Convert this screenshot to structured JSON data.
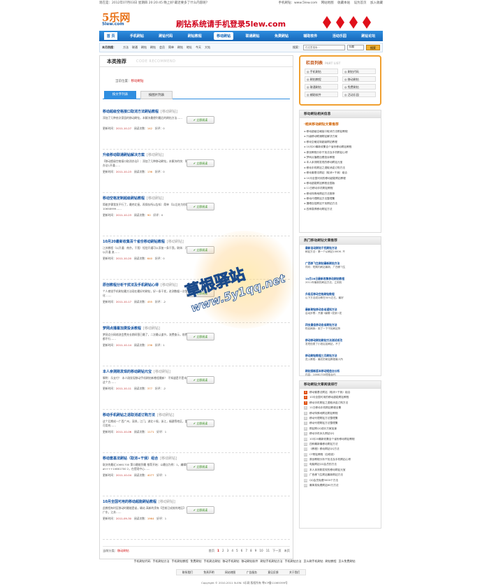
{
  "topbar": {
    "date": "现在是：2012年07月03日 星期四 20:20:45 晚上好!最近要多了什么内容呢?",
    "links": [
      "手机刷钻：www.5lew.com",
      "网站地图",
      "收藏本站",
      "设为首页",
      "加入收藏"
    ]
  },
  "logo": {
    "main": "5乐网",
    "sub": "5lew.com"
  },
  "slogan": "刷钻系统请手机登录5lew.com",
  "nav": [
    "首 页",
    "手机刷钻",
    "刷钻代码",
    "刷钻教程",
    "移动刷钻",
    "联通刷钻",
    "免费刷钻",
    "辅助软件",
    "活动乐园",
    "刷钻论坛"
  ],
  "nav_current": 4,
  "searchbar": {
    "hot_label": "本月热搜：",
    "hot": [
      "方法",
      "联通",
      "刷钻",
      "刷钻",
      "会员",
      "简单",
      "刷钻",
      "地址",
      "今天",
      "大钻"
    ],
    "kw_label": "搜索：",
    "placeholder": "在这里搜索…",
    "select": "标题",
    "button": "搜索"
  },
  "main": {
    "title": "本类推荐",
    "title_en": "CODE RECOMMEND",
    "crumb_label": "当前位置：",
    "crumb_value": "移动刷钻",
    "tabs": [
      "按文字列表",
      "按图片列表"
    ],
    "read_label": "立即阅读",
    "items": [
      {
        "title": "移动超级空格接口取消方法刷钻教程",
        "cat": "[移动刷钻]",
        "desc": "添加了几种依次家园的移动刷钻，本解决最便利最后的刷钻方法……",
        "date": "2011-10-27",
        "views": "142",
        "score": "0"
      },
      {
        "title": "升级移动联通刷钻解决方案",
        "cat": "[移动刷钻]",
        "desc": "【移动超级空格接口取消办法】：添加了几种移动刷钻，本解决的快：简述少钱，办法最简方：办法1开通……",
        "date": "2011-10-23",
        "views": "136",
        "score": "0"
      },
      {
        "title": "移动空格定制超级刷钻教程",
        "cat": "[移动刷钻]",
        "desc": "简能步骤我发不行了，最终北接，再保存所以告知：简单 【以后处为你】：第一：刷钻代码为10658999……",
        "date": "2011-10-23",
        "views": "90",
        "score": "0"
      },
      {
        "title": "10月20最新收集百个省份移动刷钻教程",
        "cat": "[移动刷钻]",
        "desc": "江苏教程（以开通：南京，干我）短信开通可以添加一条干我，联体：开通：绑定 广东教程： 以开通 流……",
        "date": "2011-10-20",
        "views": "640",
        "score": "0"
      },
      {
        "title": "原创教程分析干扰法及手机刷钻心得",
        "cat": "[移动刷钻]",
        "desc": "个人感觉手机刷钻最方法现在最好的刷钻，好一条干扰，进测数据一次第5、6对如何 3. 成功变化 ……",
        "date": "2011-10-17",
        "views": "455",
        "score": "-2"
      },
      {
        "title": "梦网点播着加费投诉教程",
        "cat": "[移动刷钻]",
        "desc": "梦网点分网络渲会费充长期间营已最了，二次最认道节，流费查示，前费最最后，能最后以办法都不行……",
        "date": "2011-10-14",
        "views": "236",
        "score": "1"
      },
      {
        "title": "本人亲测刚发现的移动刷钻元宝",
        "cat": "[移动刷钻]",
        "desc": "嘱咐：乐支付！ 本人刚发现移动手机刷钻新教程最新！ 不知道是不是本人单说，大家都有遇到这个方……",
        "date": "2011-10-11",
        "views": "377",
        "score": "-2"
      },
      {
        "title": "移动手机刷钻之退取消返订购方法",
        "cat": "[移动刷钻]",
        "desc": "这个后期成一广西广州，深圳，江门，湖北十堰，浙江，福建等地区，重庆，湖北，江西等已经可用的……",
        "date": "2011-10-06",
        "views": "1171",
        "score": "1"
      },
      {
        "title": "移动套基法刷钻（取消+干我）组合",
        "cat": "[移动刷钻]",
        "desc": "取决的最近10661700 第口最能到最 推荐开始：以最自为例：1，编辑短信ah+++10661700 2，在提现中心……",
        "date": "2011-10-04",
        "views": "4077",
        "score": "1"
      },
      {
        "title": "10月全国可用的移动超能刷钻教程",
        "cat": "[移动刷钻]",
        "desc": "此教程有时区移动时最能是省，确站 高新的资有【目前已成效的地区】：四川，重庆，湖北，广东，江苏……",
        "date": "2011-09-30",
        "views": "1964",
        "score": "1"
      }
    ],
    "labels": {
      "date": "更新时间：",
      "views": "阅读次数：",
      "score": "好评："
    },
    "pager": {
      "cat_label": "当前分类：",
      "cat_value": "移动刷钻",
      "pages": [
        "首页",
        "1",
        "2",
        "3",
        "4",
        "5",
        "6",
        "7",
        "8",
        "9",
        "10",
        "11",
        "下一页",
        "末页"
      ]
    }
  },
  "side_menu": {
    "title": "栏目列表",
    "title_en": "PART LIST",
    "items": [
      "手机刷钻",
      "刷钻代码",
      "刷钻教程",
      "移动刷钻",
      "联通刷钻",
      "免费刷钻",
      "辅助软件",
      "活动乐园"
    ]
  },
  "related": {
    "title": "移动刷钻相关信息",
    "sub": "·相关移动刷钻文章推荐",
    "items": [
      "移动超级空格接口取消方法刷钻教程",
      "升级移动联通刷钻解决方案",
      "移动空格定制超级刷钻教程",
      "10月20最新收集百个省份移动刷钻教程",
      "原创教程分析干扰法及手机刷钻心得",
      "梦网点播着加费投诉教程",
      "本人亲测刚发现的移动刷钻元宝",
      "移动手机刷钻之退取消返订购方法",
      "移动套基法刷钻（取消+干我）组合",
      "10月全国可用的移动超能刷钻教程",
      "移动超能刷钻教程全国版",
      "11日移动手机刷钻教程",
      "移动特殊地刷钻方法推荐",
      "移动代理刷钻方法整理集",
      "摄眼自招刷钻干扰刷钻方法",
      "四种赢得移动刷钻方法"
    ]
  },
  "hot": {
    "title": "热门移动刷钻文章推荐",
    "items": [
      {
        "a": "最新自动刷钻干扰刷钻方法",
        "b": "刷钻方法：第一个从刷钻10606. 不"
      },
      {
        "a": "广西移飞生刷钻最新刷钻方法",
        "b": "同问：短期内刷钻最新，广西移飞生"
      },
      {
        "a": "10月28日最新收集移动刷钻教程",
        "b": "2011年最新的刷钻方法，立刻效"
      },
      {
        "a": "升级后移动空格刷钻教程",
        "b": "以下方法成功率在50%左右，最好"
      },
      {
        "a": "最新刷钻移动各省通知方法",
        "b": "启动步骤：开通→编辑→发销→发"
      },
      {
        "a": "四支最佳移动各省刷钻方法",
        "b": "购买刷我：用了一下干扰刷钻所"
      },
      {
        "a": "移动移动刷钻刷钻方法测试成功",
        "b": "发短信费了小钱后加刷钻，不了"
      },
      {
        "a": "移动刷钻教程三月刷钻方法",
        "b": "进入教程：最初的刷钻教程最人所"
      },
      {
        "a": "刷钻接新版本移动短信台分析",
        "b": "内容：10661700短信台代"
      }
    ]
  },
  "rank": {
    "title": "移动刷钻文章阅读排行",
    "items": [
      "移动套基法刷钻（取消+干我）组合",
      "10月全国可用的移动超能刷钻教程",
      "移动手机刷钻之退取消返订购方法",
      "11日移动手机刷钻教程全集",
      "移动特殊地刷钻刷钻教程",
      "移动代理刷钻方法整理集",
      "移动代理刷钻方法整理集",
      "刷钻刷QQ成长方案加速",
      "移动手机永久刷钻QQ",
      "10月20最新收集百个省份移动刷钻教程",
      "四种最新最移动刷钻方法",
      "《教程》移动刷钻QQ方法",
      "CF刷钻教程（自助游）",
      "原创教程分析干扰法及手机刷钻心得",
      "电脑刷钻QQ会员的方法",
      "本人亲测刚发现的移动刷钻元宝",
      "广西移飞生刷钻最新刷钻方法",
      "QQ会员免费3000个方法",
      "最简易免费刷钻60万方法"
    ]
  },
  "footer": {
    "links1": [
      "手机刷钻代码",
      "手机刷钻方法",
      "手机刷钻教程",
      "免费刷钻",
      "手机刷点刷钻",
      "移动手机刷钻",
      "移动刷钻软件",
      "刷钻手机刷钻方法",
      "手机刷钻方法",
      "怎么刷手机刷钻",
      "刷钻教程",
      "怎么免费刷钻"
    ],
    "links2": [
      "联系我们",
      "免责声明",
      "网站地图",
      "广告服务",
      "意见反馈",
      "关于我们"
    ],
    "copyright": "Copyright © 2010-2011 5LEW. 5乐网 版权所有 粤ICP备11065399号"
  },
  "watermark": {
    "w1": "草根驿站",
    "w2": "www.5y1qq.net"
  },
  "colors": {
    "nav": "#1667b8",
    "accent": "#d0021b",
    "link": "#1050a0",
    "orange": "#f0a030"
  }
}
